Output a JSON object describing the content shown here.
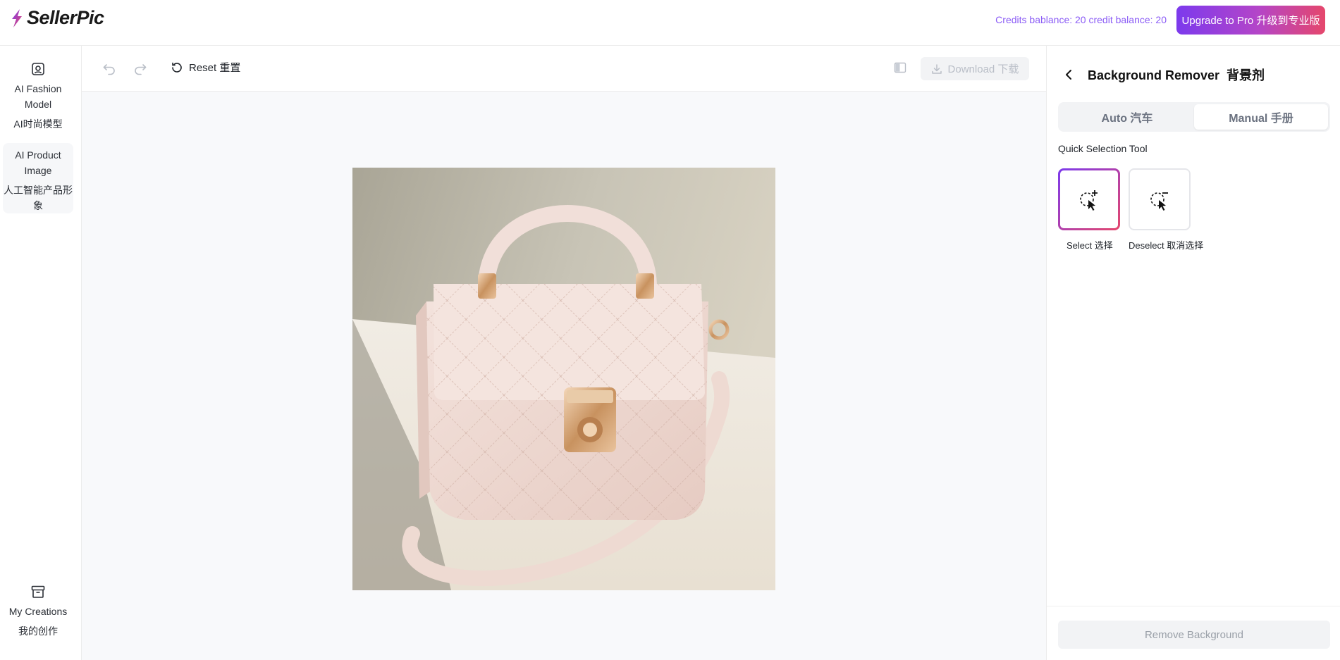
{
  "app": {
    "logo_text": "SellerPic",
    "credits_text": "Credits bablance: 20 credit balance: 20",
    "upgrade_label": "Upgrade to Pro 升级到专业版",
    "accent_color": "#8b5cf6"
  },
  "sidebar": {
    "items": [
      {
        "label": "AI Fashion Model",
        "sublabel": "AI时尚模型",
        "icon": "user-square-icon"
      },
      {
        "label": "AI Product Image",
        "sublabel": "人工智能产品形象",
        "icon": ""
      },
      {
        "label": "My Creations",
        "sublabel": "我的创作",
        "icon": "archive-box-icon"
      }
    ]
  },
  "toolbar": {
    "reset_label": "Reset 重置",
    "download_label": "Download 下载"
  },
  "panel": {
    "title": "Background Remover  背景剂",
    "tabs": [
      {
        "label": "Auto 汽车",
        "active": false
      },
      {
        "label": "Manual 手册",
        "active": true
      }
    ],
    "section_label": "Quick Selection Tool",
    "tools": [
      {
        "label": "Select 选择",
        "icon": "select-add-icon",
        "active": true
      },
      {
        "label": "Deselect 取消选择",
        "icon": "select-remove-icon",
        "active": false
      }
    ],
    "remove_button_label": "Remove Background"
  }
}
